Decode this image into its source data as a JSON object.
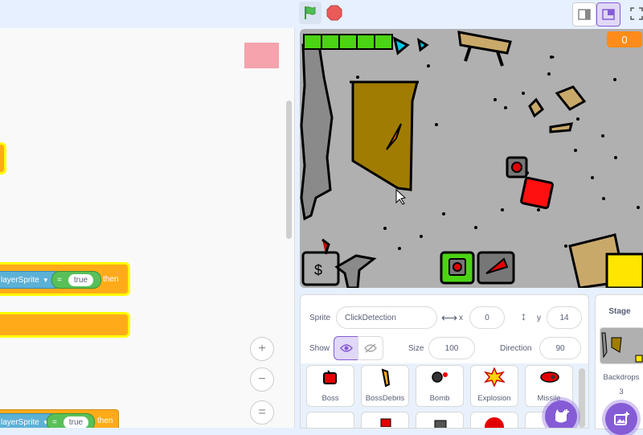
{
  "code": {
    "blocks": [
      {
        "reporter": "layerSprite",
        "op": "=",
        "value": "true",
        "suffix": "then"
      },
      {
        "reporter": "layerSprite",
        "op": "=",
        "value": "true",
        "suffix": "then"
      }
    ],
    "zoom_in": "+",
    "zoom_out": "−",
    "zoom_reset": "="
  },
  "stage": {
    "score": "0"
  },
  "sprite_info": {
    "sprite_label": "Sprite",
    "sprite_name": "ClickDetection",
    "x_label": "x",
    "x_value": "0",
    "y_label": "y",
    "y_value": "14",
    "show_label": "Show",
    "size_label": "Size",
    "size_value": "100",
    "direction_label": "Direction",
    "direction_value": "90"
  },
  "sprites": [
    {
      "name": "Boss"
    },
    {
      "name": "BossDebris"
    },
    {
      "name": "Bomb"
    },
    {
      "name": "Explosion"
    },
    {
      "name": "Missile"
    }
  ],
  "stage_panel": {
    "title": "Stage",
    "backdrops_label": "Backdrops",
    "backdrops_count": "3"
  },
  "colors": {
    "accent": "#855cd6",
    "flag": "#4cbf56",
    "stop": "#ec5959",
    "score_bg": "#ff8c1a"
  }
}
